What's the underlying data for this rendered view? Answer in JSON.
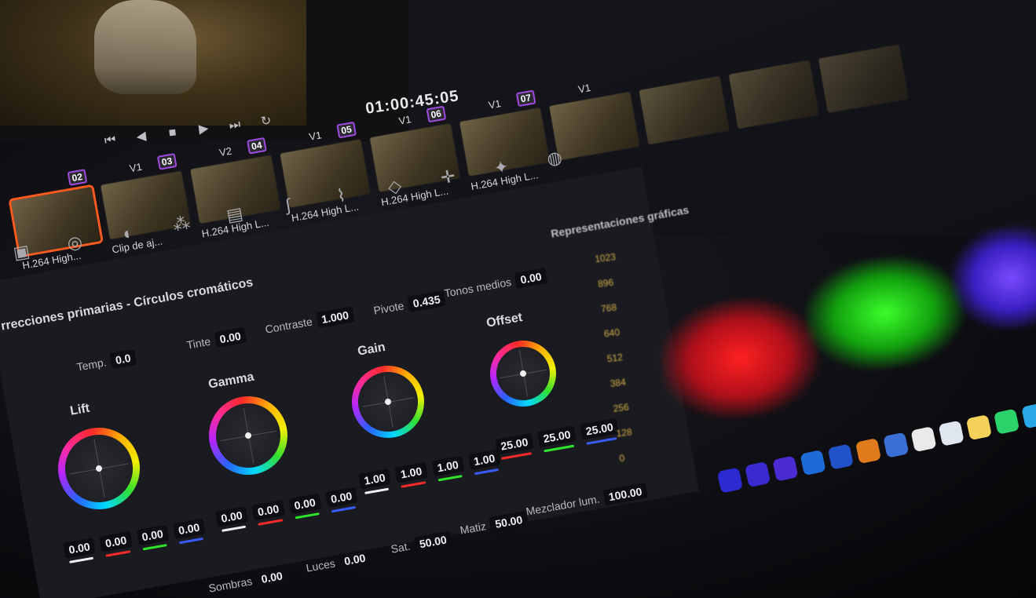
{
  "viewer": {
    "timecode": "01:00:45:05"
  },
  "transport": {
    "skip_back": "⏮",
    "play_reverse": "◀",
    "stop": "■",
    "play": "▶",
    "skip_forward": "⏭",
    "loop": "↻"
  },
  "clips": [
    {
      "num": "02",
      "track": "",
      "caption": "H.264 High..."
    },
    {
      "num": "03",
      "track": "V1",
      "caption": "Clip de aj..."
    },
    {
      "num": "04",
      "track": "V2",
      "caption": "H.264 High L..."
    },
    {
      "num": "05",
      "track": "V1",
      "caption": "H.264 High L..."
    },
    {
      "num": "06",
      "track": "V1",
      "caption": "H.264 High L..."
    },
    {
      "num": "07",
      "track": "V1",
      "caption": "H.264 High L..."
    },
    {
      "num": "",
      "track": "V1",
      "caption": ""
    }
  ],
  "panel": {
    "title": "rrecciones primarias - Círculos cromáticos",
    "contrast_label": "Contraste",
    "contrast_value": "1.000",
    "pivot_label": "Pivote",
    "pivot_value": "0.435",
    "midtones_label": "Tonos medios",
    "midtones_value": "0.00",
    "tint_label": "Tinte",
    "tint_value": "0.00",
    "temp_label": "Temp.",
    "temp_value": "0.0",
    "sat_label": "Sat.",
    "sat_value": "50.00",
    "hue_label": "Matiz",
    "hue_value": "50.00",
    "lum_mix_label": "Mezclador lum.",
    "lum_mix_value": "100.00",
    "highlights_label": "Luces",
    "highlights_value": "0.00",
    "shadows_label": "Sombras",
    "shadows_value": "0.00"
  },
  "wheels": {
    "lift": {
      "label": "Lift",
      "values": [
        "0.00",
        "0.00",
        "0.00",
        "0.00"
      ]
    },
    "gamma": {
      "label": "Gamma",
      "values": [
        "0.00",
        "0.00",
        "0.00",
        "0.00"
      ]
    },
    "gain": {
      "label": "Gain",
      "values": [
        "1.00",
        "1.00",
        "1.00",
        "1.00"
      ]
    },
    "offset": {
      "label": "Offset",
      "values": [
        "25.00",
        "25.00",
        "25.00"
      ]
    }
  },
  "scope": {
    "title": "Representaciones gráficas",
    "ticks": [
      "1023",
      "896",
      "768",
      "640",
      "512",
      "384",
      "256",
      "128",
      "0"
    ]
  },
  "colors": {
    "selected_clip": "#ff5a1f",
    "badge_border": "#a04ae0",
    "red": "#ff2a2a",
    "green": "#2ee62a",
    "blue": "#3a5cff",
    "white": "#f0f0f0"
  }
}
